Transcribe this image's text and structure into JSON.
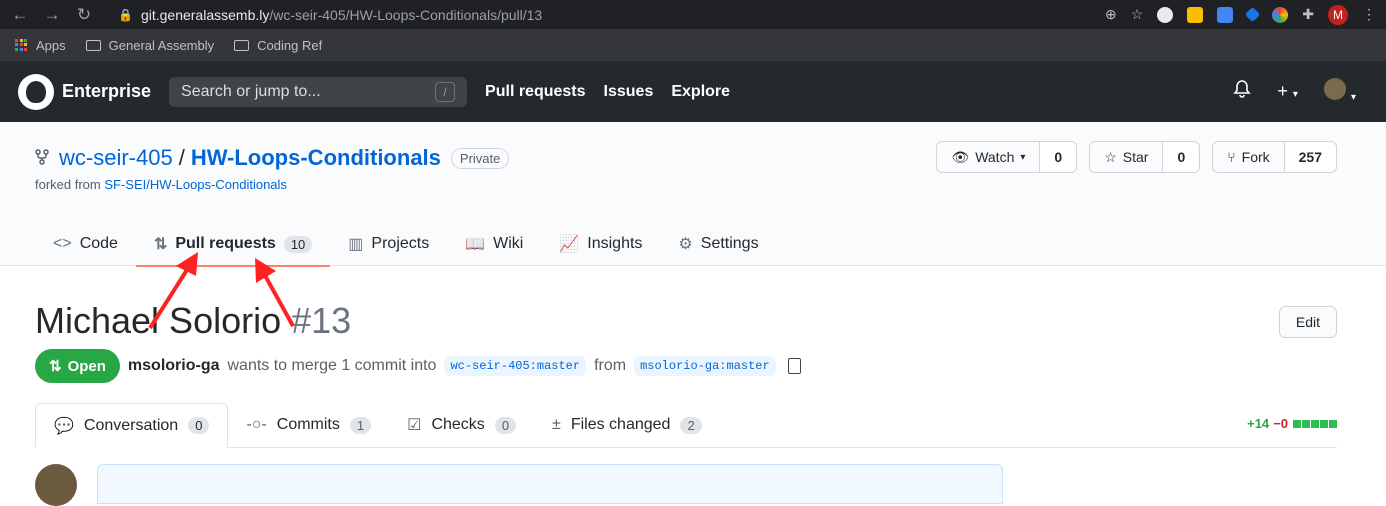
{
  "browser": {
    "url_host": "git.generalassemb.ly",
    "url_path": "/wc-seir-405/HW-Loops-Conditionals/pull/13",
    "profile_initial": "M",
    "bookmarks": [
      "Apps",
      "General Assembly",
      "Coding Ref"
    ]
  },
  "header": {
    "brand": "Enterprise",
    "search_placeholder": "Search or jump to...",
    "search_key": "/",
    "nav": [
      "Pull requests",
      "Issues",
      "Explore"
    ]
  },
  "repo": {
    "owner": "wc-seir-405",
    "separator": "/",
    "name": "HW-Loops-Conditionals",
    "visibility": "Private",
    "forked_prefix": "forked from ",
    "forked_from": "SF-SEI/HW-Loops-Conditionals",
    "watch_label": "Watch",
    "watch_count": "0",
    "star_label": "Star",
    "star_count": "0",
    "fork_label": "Fork",
    "fork_count": "257",
    "tabs": [
      {
        "label": "Code",
        "icon": "code-icon"
      },
      {
        "label": "Pull requests",
        "icon": "pull-request-icon",
        "count": "10"
      },
      {
        "label": "Projects",
        "icon": "project-icon"
      },
      {
        "label": "Wiki",
        "icon": "book-icon"
      },
      {
        "label": "Insights",
        "icon": "graph-icon"
      },
      {
        "label": "Settings",
        "icon": "gear-icon"
      }
    ]
  },
  "pr": {
    "title": "Michael Solorio",
    "number": "#13",
    "edit_label": "Edit",
    "state": "Open",
    "author": "msolorio-ga",
    "merge_text": "wants to merge 1 commit into",
    "base_ref": "wc-seir-405:master",
    "from_text": "from",
    "head_ref": "msolorio-ga:master",
    "tabs": [
      {
        "label": "Conversation",
        "count": "0"
      },
      {
        "label": "Commits",
        "count": "1"
      },
      {
        "label": "Checks",
        "count": "0"
      },
      {
        "label": "Files changed",
        "count": "2"
      }
    ],
    "additions": "+14",
    "deletions": "−0"
  },
  "colors": {
    "accent": "#0366d6",
    "open_green": "#28a745",
    "tab_underline": "#f9826c",
    "annotation_arrow": "#f22"
  }
}
